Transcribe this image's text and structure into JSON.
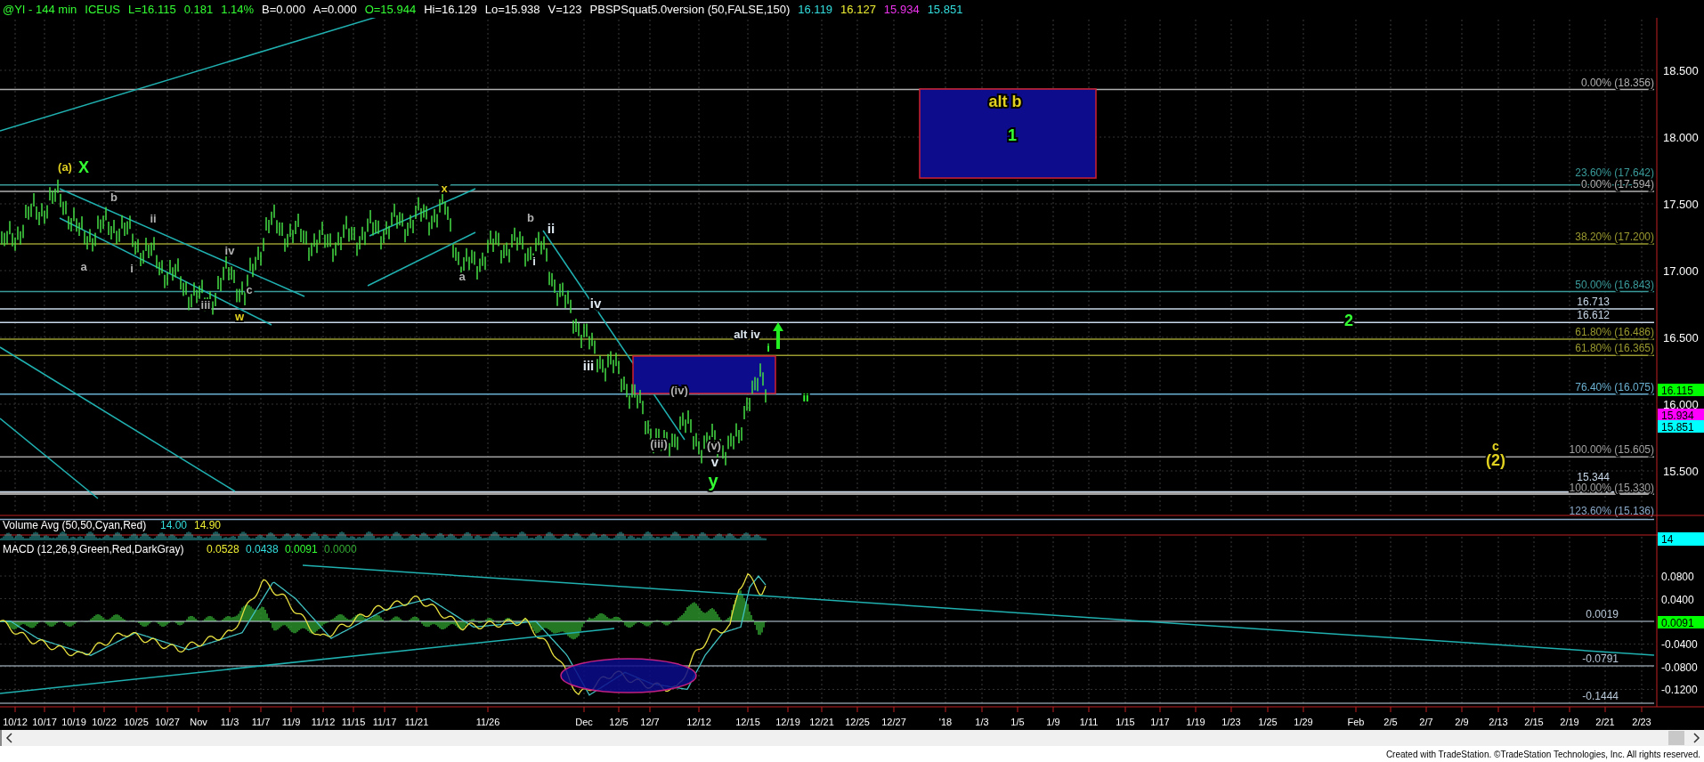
{
  "header": [
    {
      "text": "@YI - 144 min",
      "color": "#33ff33"
    },
    {
      "text": "ICEUS",
      "color": "#33ff33"
    },
    {
      "text": "L=16.115",
      "color": "#33ff33"
    },
    {
      "text": "0.181",
      "color": "#33ff33"
    },
    {
      "text": "1.14%",
      "color": "#33ff33"
    },
    {
      "text": "B=0.000",
      "color": "#ffffff"
    },
    {
      "text": "A=0.000",
      "color": "#ffffff"
    },
    {
      "text": "O=15.944",
      "color": "#33ff33"
    },
    {
      "text": "Hi=16.129",
      "color": "#ffffff"
    },
    {
      "text": "Lo=15.938",
      "color": "#ffffff"
    },
    {
      "text": "V=123",
      "color": "#ffffff"
    },
    {
      "text": "PBSPSquat5.0version (50,FALSE,150)",
      "color": "#ffffff"
    },
    {
      "text": "16.119",
      "color": "#33dddd"
    },
    {
      "text": "16.127",
      "color": "#eeee33"
    },
    {
      "text": "15.934",
      "color": "#ee33ee"
    },
    {
      "text": "15.851",
      "color": "#33dddd"
    }
  ],
  "price_panel": {
    "fib_levels": [
      {
        "label": "0.00% (18.356)",
        "color": "#b0b0b0"
      },
      {
        "label": "23.60% (17.642)",
        "color": "#3a9a9a"
      },
      {
        "label": "0.00% (17.594)",
        "color": "#b0b0b0"
      },
      {
        "label": "38.20% (17.200)",
        "color": "#9a9a30"
      },
      {
        "label": "50.00% (16.843)",
        "color": "#3a9a9a"
      },
      {
        "label": "16.713",
        "color": "#c8d8e8"
      },
      {
        "label": "16.612",
        "color": "#c8d8e8"
      },
      {
        "label": "61.80% (16.486)",
        "color": "#9a9a30"
      },
      {
        "label": "61.80% (16.365)",
        "color": "#9a9a30"
      },
      {
        "label": "76.40% (16.075)",
        "color": "#6ab0d0"
      },
      {
        "label": "100.00% (15.605)",
        "color": "#a0a0a0"
      },
      {
        "label": "15.344",
        "color": "#c8d8e8"
      },
      {
        "label": "100.00% (15.330)",
        "color": "#a0a0a0"
      },
      {
        "label": "123.60% (15.136)",
        "color": "#8aa8c8"
      }
    ],
    "annotations": [
      {
        "text": "(a)",
        "color": "#e0d020"
      },
      {
        "text": "X",
        "color": "#33ff33"
      },
      {
        "text": "b",
        "color": "#b0b0b0"
      },
      {
        "text": "ii",
        "color": "#b0b0b0"
      },
      {
        "text": "a",
        "color": "#b0b0b0"
      },
      {
        "text": "i",
        "color": "#b0b0b0"
      },
      {
        "text": "iv",
        "color": "#b0b0b0"
      },
      {
        "text": "iii",
        "color": "#b0b0b0"
      },
      {
        "text": "c",
        "color": "#b0b0b0"
      },
      {
        "text": "w",
        "color": "#e0d020"
      },
      {
        "text": "x",
        "color": "#e0d020"
      },
      {
        "text": "a",
        "color": "#b0b0b0"
      },
      {
        "text": "b",
        "color": "#b0b0b0"
      },
      {
        "text": "ii",
        "color": "#dde8f0"
      },
      {
        "text": "i",
        "color": "#dde8f0"
      },
      {
        "text": "iv",
        "color": "#dde8f0"
      },
      {
        "text": "iii",
        "color": "#dde8f0"
      },
      {
        "text": "(iii)",
        "color": "#b0b0b0"
      },
      {
        "text": "(iv)",
        "color": "#b0b0b0"
      },
      {
        "text": "(v)",
        "color": "#b0b0b0"
      },
      {
        "text": "v",
        "color": "#dde8f0"
      },
      {
        "text": "y",
        "color": "#33ff33"
      },
      {
        "text": "alt iv",
        "color": "#dde8f0"
      },
      {
        "text": "i",
        "color": "#33ff33"
      },
      {
        "text": "ii",
        "color": "#33ff33"
      },
      {
        "text": "alt b",
        "color": "#e0d020"
      },
      {
        "text": "1",
        "color": "#33ff33"
      },
      {
        "text": "2",
        "color": "#33ff33"
      },
      {
        "text": "c",
        "color": "#e0d020"
      },
      {
        "text": "(2)",
        "color": "#e0d020"
      }
    ],
    "axis_labels": [
      "18.500",
      "18.000",
      "17.500",
      "17.000",
      "16.500",
      "16.000",
      "15.500"
    ],
    "badges": [
      {
        "text": "16.115",
        "color": "#00ff00"
      },
      {
        "text": "15.934",
        "color": "#ff00ff"
      },
      {
        "text": "15.851",
        "color": "#00ffff"
      }
    ]
  },
  "volume_panel": {
    "title": "Volume Avg (50,50,Cyan,Red)",
    "values": [
      {
        "text": "14.00",
        "color": "#33dddd"
      },
      {
        "text": "14.90",
        "color": "#eeee33"
      }
    ],
    "badge": {
      "text": "14",
      "color": "#00ffff"
    }
  },
  "macd_panel": {
    "title": "MACD (12,26,9,Green,Red,DarkGray)",
    "values": [
      {
        "text": "0.0528",
        "color": "#eeee33"
      },
      {
        "text": "0.0438",
        "color": "#33dddd"
      },
      {
        "text": "0.0091",
        "color": "#33ff33"
      },
      {
        "text": "0.0000",
        "color": "#33aa33"
      }
    ],
    "line_labels": [
      "0.0019",
      "-0.0791",
      "-0.1444"
    ],
    "axis_labels": [
      "0.0800",
      "0.0400",
      "-0.0400",
      "-0.0800",
      "-0.1200"
    ],
    "badge": {
      "text": "0.0091",
      "color": "#00ff00"
    }
  },
  "x_axis": [
    "10/12",
    "10/17",
    "10/19",
    "10/22",
    "10/25",
    "10/27",
    "Nov",
    "11/3",
    "11/7",
    "11/9",
    "11/12",
    "11/15",
    "11/17",
    "11/21",
    "11/26",
    "Dec",
    "12/5",
    "12/7",
    "12/12",
    "12/15",
    "12/19",
    "12/21",
    "12/25",
    "12/27",
    "'18",
    "1/3",
    "1/5",
    "1/9",
    "1/11",
    "1/15",
    "1/17",
    "1/19",
    "1/23",
    "1/25",
    "1/29",
    "Feb",
    "2/5",
    "2/7",
    "2/9",
    "2/13",
    "2/15",
    "2/19",
    "2/21",
    "2/23"
  ],
  "footer": "Created with TradeStation. ©TradeStation Technologies, Inc. All rights reserved."
}
